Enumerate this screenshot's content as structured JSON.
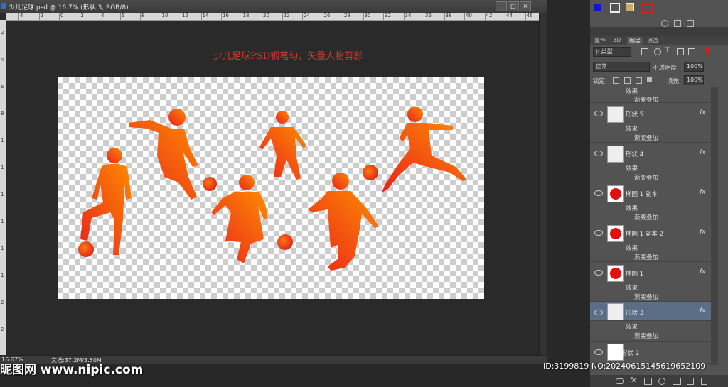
{
  "document": {
    "title": "少儿足球.psd @ 16.7% (形状 3, RGB/8)",
    "caption": "少儿足球PSD钢笔勾，矢量人物剪影",
    "ruler_numbers": [
      "4",
      "2",
      "0",
      "2",
      "4",
      "6",
      "8",
      "10",
      "12",
      "14",
      "16",
      "18",
      "20",
      "22",
      "24",
      "26",
      "28",
      "30",
      "32",
      "34",
      "36",
      "38",
      "40",
      "42",
      "44",
      "46"
    ],
    "ruler_left_numbers": [
      "2",
      "4",
      "6",
      "8",
      "1",
      "1",
      "1",
      "1",
      "1",
      "1",
      "2",
      "2"
    ]
  },
  "status": {
    "zoom": "16.67%",
    "doc_info": "文档:37.2M/3.50M"
  },
  "window_buttons": {
    "minimize": "_",
    "maximize": "□",
    "close": "×"
  },
  "panel": {
    "tabs": [
      "属性",
      "3D",
      "图层",
      "通道"
    ],
    "active_tab": "图层",
    "filter_kind": "ρ 类型",
    "blend_mode": "正常",
    "opacity_label": "不透明度:",
    "opacity_value": "100%",
    "lock_label": "锁定:",
    "fill_label": "填充:",
    "fill_value": "100%"
  },
  "layers": [
    {
      "name": "",
      "effects_label": "效果",
      "effect": "",
      "partial": true
    },
    {
      "name": "形状 5",
      "effects_label": "效果",
      "effect": "渐变叠加",
      "thumb": "checker"
    },
    {
      "name": "形状 4",
      "effects_label": "效果",
      "effect": "渐变叠加",
      "thumb": "checker"
    },
    {
      "name": "椭圆 1 副本",
      "effects_label": "效果",
      "effect": "渐变叠加",
      "thumb": "red"
    },
    {
      "name": "椭圆 1 副本 2",
      "effects_label": "效果",
      "effect": "渐变叠加",
      "thumb": "red"
    },
    {
      "name": "椭圆 1",
      "effects_label": "效果",
      "effect": "渐变叠加",
      "thumb": "red"
    },
    {
      "name": "形状 3",
      "effects_label": "效果",
      "effect": "渐变叠加",
      "thumb": "checker",
      "selected": true
    },
    {
      "name": "形状 2",
      "thumb": "white"
    }
  ],
  "layer_labels": {
    "l0_effects": "效果",
    "l0_effect": "渐变叠加",
    "fx": "fx"
  },
  "watermark": {
    "site": "昵图网 www.nipic.com",
    "id": "ID:3199819 NO:20240615145619652109"
  },
  "colors": {
    "silhouette_start": "#e8231e",
    "silhouette_end": "#ff8a00",
    "caption": "#d23a2a",
    "selected_layer": "#5b6e86"
  },
  "icons": [
    "eye-icon",
    "fx-icon",
    "lock-icon",
    "chain-icon",
    "trash-icon",
    "new-layer-icon",
    "folder-icon",
    "mask-icon"
  ]
}
